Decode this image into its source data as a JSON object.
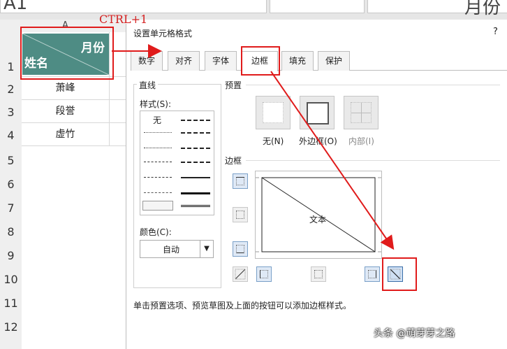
{
  "topbar": {
    "left_text": "A1",
    "right_text": "月份"
  },
  "sheet": {
    "column_a_label": "A",
    "row_numbers": [
      "1",
      "2",
      "3",
      "4",
      "5",
      "6",
      "7",
      "8",
      "9",
      "10",
      "11",
      "12"
    ],
    "header_cell_top_right": "月份",
    "header_cell_bottom_left": "姓名",
    "names": [
      "萧峰",
      "段誉",
      "虚竹"
    ]
  },
  "annotation": {
    "shortcut": "CTRL+1"
  },
  "dialog": {
    "title": "设置单元格格式",
    "help": "?",
    "tabs": [
      {
        "label": "数字"
      },
      {
        "label": "对齐"
      },
      {
        "label": "字体"
      },
      {
        "label": "边框",
        "active": true
      },
      {
        "label": "填充"
      },
      {
        "label": "保护"
      }
    ],
    "line_group": {
      "title": "直线",
      "style_label": "样式(S):",
      "none_label": "无",
      "color_label": "颜色(C):",
      "color_value": "自动"
    },
    "preset_group": {
      "title": "预置",
      "buttons": [
        {
          "label": "无(N)",
          "icon": "preset-none-icon"
        },
        {
          "label": "外边框(O)",
          "icon": "preset-outline-icon"
        },
        {
          "label": "内部(I)",
          "icon": "preset-inside-icon"
        }
      ]
    },
    "border_group": {
      "title": "边框",
      "preview_text": "文本"
    },
    "hint": "单击预置选项、预览草图及上面的按钮可以添加边框样式。"
  },
  "watermark": "头条 @萌芽芽之路",
  "colors": {
    "header_fill": "#4e8c84",
    "annotation_red": "#e01b1b"
  }
}
